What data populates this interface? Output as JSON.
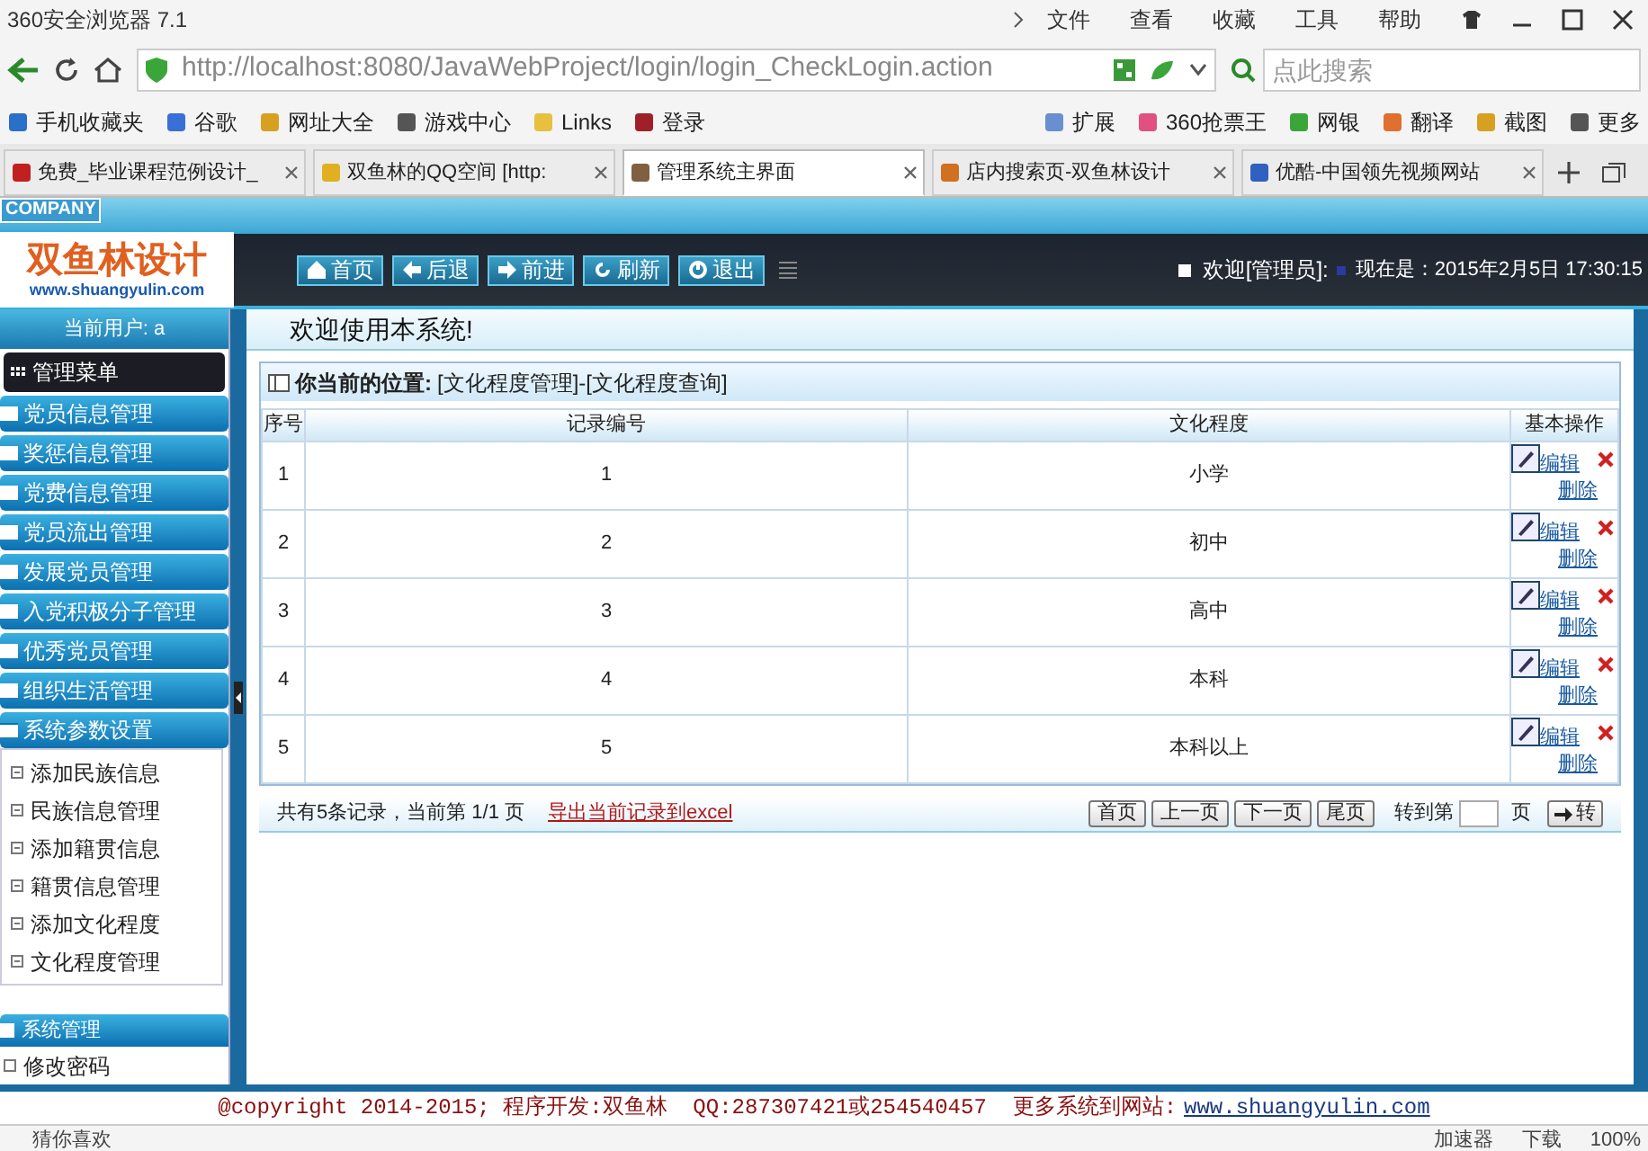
{
  "browser": {
    "title": "360安全浏览器 7.1",
    "menu": [
      "文件",
      "查看",
      "收藏",
      "工具",
      "帮助"
    ],
    "url": "http://localhost:8080/JavaWebProject/login/login_CheckLogin.action",
    "search": {
      "placeholder": "点此搜索"
    },
    "bookmarks": [
      "手机收藏夹",
      "谷歌",
      "网址大全",
      "游戏中心",
      "Links",
      "登录"
    ],
    "extensions": [
      "扩展",
      "360抢票王",
      "网银",
      "翻译",
      "截图",
      "更多"
    ],
    "tabs": [
      {
        "label": "免费_毕业课程范例设计_",
        "selected": false
      },
      {
        "label": "双鱼林的QQ空间 [http:",
        "selected": false
      },
      {
        "label": "管理系统主界面",
        "selected": true
      },
      {
        "label": "店内搜索页-双鱼林设计",
        "selected": false
      },
      {
        "label": "优酷-中国领先视频网站",
        "selected": false
      }
    ]
  },
  "header": {
    "badge": "COMPANY",
    "logo": "双鱼林设计",
    "logo_url": "www.shuangyulin.com",
    "nav": [
      "首页",
      "后退",
      "前进",
      "刷新",
      "退出"
    ],
    "welcome": "欢迎[管理员]:",
    "time": "现在是：2015年2月5日 17:30:15"
  },
  "sidebar": {
    "user": "当前用户: a",
    "title": "管理菜单",
    "groups": [
      {
        "label": "党员信息管理",
        "expanded": false
      },
      {
        "label": "奖惩信息管理",
        "expanded": false
      },
      {
        "label": "党费信息管理",
        "expanded": false
      },
      {
        "label": "党员流出管理",
        "expanded": false
      },
      {
        "label": "发展党员管理",
        "expanded": false
      },
      {
        "label": "入党积极分子管理",
        "expanded": false
      },
      {
        "label": "优秀党员管理",
        "expanded": false
      },
      {
        "label": "组织生活管理",
        "expanded": false
      },
      {
        "label": "系统参数设置",
        "expanded": true,
        "children": [
          {
            "label": "添加民族信息"
          },
          {
            "label": "民族信息管理"
          },
          {
            "label": "添加籍贯信息"
          },
          {
            "label": "籍贯信息管理"
          },
          {
            "label": "添加文化程度"
          },
          {
            "label": "文化程度管理"
          }
        ]
      }
    ],
    "section": {
      "label": "系统管理",
      "items": [
        "修改密码"
      ]
    }
  },
  "main": {
    "welcome": "欢迎使用本系统!",
    "breadcrumb_label": "你当前的位置:",
    "breadcrumb": "[文化程度管理]-[文化程度查询]",
    "table": {
      "columns": [
        "序号",
        "记录编号",
        "文化程度",
        "基本操作"
      ],
      "rows": [
        {
          "cells": [
            "1",
            "1",
            "小学"
          ],
          "edit": "编辑",
          "delete": "删除"
        },
        {
          "cells": [
            "2",
            "2",
            "初中"
          ],
          "edit": "编辑",
          "delete": "删除"
        },
        {
          "cells": [
            "3",
            "3",
            "高中"
          ],
          "edit": "编辑",
          "delete": "删除"
        },
        {
          "cells": [
            "4",
            "4",
            "本科"
          ],
          "edit": "编辑",
          "delete": "删除"
        },
        {
          "cells": [
            "5",
            "5",
            "本科以上"
          ],
          "edit": "编辑",
          "delete": "删除"
        }
      ]
    },
    "pager": {
      "summary": "共有5条记录，当前第 1/1 页",
      "export": "导出当前记录到excel",
      "buttons": [
        "首页",
        "上一页",
        "下一页",
        "尾页"
      ],
      "goto_label": "转到第",
      "goto_suffix": "页",
      "go": "转"
    }
  },
  "footer": {
    "text": "@copyright 2014-2015; 程序开发:双鱼林  QQ:287307421或254540457  更多系统到网站:",
    "link": "www.shuangyulin.com"
  },
  "status_bar": [
    "猜你喜欢",
    "加速器",
    "下载",
    "100%"
  ]
}
